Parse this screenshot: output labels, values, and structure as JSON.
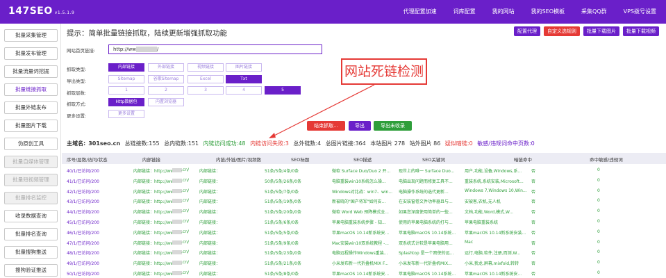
{
  "app": {
    "logo": "147SEO",
    "version": "v1.5.1.9"
  },
  "topnav": [
    "代理配置加速",
    "词库配置",
    "我的网站",
    "我的SEO模板",
    "采集QQ群",
    "VPS拨号设置"
  ],
  "sidebar": [
    {
      "label": "批量采集管理",
      "state": "normal"
    },
    {
      "label": "批量发布管理",
      "state": "normal"
    },
    {
      "label": "批量流量词挖掘",
      "state": "normal"
    },
    {
      "label": "批量链接抓取",
      "state": "active"
    },
    {
      "label": "批量外链发布",
      "state": "normal"
    },
    {
      "label": "批量图片下载",
      "state": "normal"
    },
    {
      "label": "伪原创工具",
      "state": "normal"
    },
    {
      "label": "批量自媒体管理",
      "state": "disabled"
    },
    {
      "label": "批量短视频管理",
      "state": "disabled"
    },
    {
      "label": "批量排名监控",
      "state": "disabled"
    },
    {
      "label": "收录数据查询",
      "state": "normal"
    },
    {
      "label": "批量排名查询",
      "state": "normal"
    },
    {
      "label": "批量搜狗推送",
      "state": "normal"
    },
    {
      "label": "搜狗验证推送",
      "state": "normal"
    }
  ],
  "tip": "提示：简单批量链接抓取，陆续更新增强抓取功能",
  "top_actions": [
    {
      "label": "配置代理",
      "color": "purple"
    },
    {
      "label": "自定义选规则",
      "color": "red"
    },
    {
      "label": "批量下载图片",
      "color": "purple"
    },
    {
      "label": "批量下载视频",
      "color": "purple"
    }
  ],
  "form": {
    "url_label": "网站首页链接:",
    "url_prefix": "http://ww",
    "url_suffix": "/",
    "grab_type_label": "抓取类型:",
    "grab_types": [
      {
        "label": "内部链接",
        "selected": true
      },
      {
        "label": "外部链接",
        "selected": false
      },
      {
        "label": "视频链接",
        "selected": false
      },
      {
        "label": "图片链接",
        "selected": false
      }
    ],
    "export_label": "导出类型:",
    "export_types": [
      {
        "label": "Sitemap",
        "selected": false
      },
      {
        "label": "谷歌Sitemap",
        "selected": false
      },
      {
        "label": "Excel",
        "selected": false
      },
      {
        "label": "Txt",
        "selected": true
      }
    ],
    "depth_label": "抓取层数:",
    "depths": [
      {
        "label": "1",
        "selected": false
      },
      {
        "label": "2",
        "selected": false
      },
      {
        "label": "3",
        "selected": false
      },
      {
        "label": "4",
        "selected": false
      },
      {
        "label": "5",
        "selected": true
      }
    ],
    "method_label": "抓取方式:",
    "methods": [
      {
        "label": "Http数据包",
        "selected": true
      },
      {
        "label": "内置浏览器",
        "selected": false
      }
    ],
    "more_label": "更多设置:",
    "more_button": "更多设置"
  },
  "actions": {
    "stop": "结束抓取...",
    "export": "导出",
    "export_fail": "导出未收录"
  },
  "annotation": "网站死链检测",
  "stats": {
    "domain_label": "主域名:",
    "domain": "301seo.cn",
    "total": "总链接数:155",
    "internal": "总内链数:151",
    "success": "内链访问成功:48",
    "fail": "内链访问失败:3",
    "external": "总外链数:4",
    "images": "总图片链接:364",
    "site_images": "本站图片 278",
    "ext_images": "站外图片 86",
    "dark_links": "疑似暗链:0",
    "sensitive": "敏感/违规词命中页数:0"
  },
  "table": {
    "headers": [
      "序号/层数/访问/状态",
      "内部链接",
      "内链/外链/图片/视频数",
      "SEO标题",
      "SEO描述",
      "SEO关键词",
      "暗链命中",
      "命中敏感/违规词"
    ],
    "rows": [
      {
        "status": "40/1/已访问/200",
        "link": "内部链接：http://www.3",
        "link_end": ".cn/",
        "link2": "内部链接：",
        "counts": "51条/5条/4条/0条",
        "title": "微软 Surface Duo/Duo 2 开...",
        "desc": "现世上的唯一 Surface Duo...",
        "keywords": "用户,功能,设备,Windows,系...",
        "dark": "否",
        "hit": "0"
      },
      {
        "status": "41/1/已访问/200",
        "link": "内部链接：http://www.3",
        "link_end": ".cn/",
        "link2": "内部链接：",
        "counts": "50条/5条/26条/0条",
        "title": "电脑重装win10系统怎么操...",
        "desc": "电脑出现问题而修复工具不...",
        "keywords": "重装系统,系统安装,Microsoft...",
        "dark": "否",
        "hit": "0"
      },
      {
        "status": "42/1/已访问/200",
        "link": "内部链接：http://www.",
        "link_end": ".cn/",
        "link2": "内部链接：",
        "counts": "51条/5条/7条/0条",
        "title": "Windows对比战：win7、win...",
        "desc": "电脑操作系统的选代更新...",
        "keywords": "Windows 7,Windows 10,Win...",
        "dark": "否",
        "hit": "0"
      },
      {
        "status": "43/1/已访问/200",
        "link": "内部链接：http://www.",
        "link_end": ".cn/",
        "link2": "内部链接：",
        "counts": "51条/5条/19条/0条",
        "title": "新被晓的\"国产将军\"如何安...",
        "desc": "在安装窗卷文件功率器且与...",
        "keywords": "安被客,农机,无人机",
        "dark": "否",
        "hit": "0"
      },
      {
        "status": "44/1/已访问/200",
        "link": "内部链接：http://www.",
        "link_end": ".cn/",
        "link2": "内部链接：",
        "counts": "51条/5条/20条/0条",
        "title": "微软 Word Web 预降模式全...",
        "desc": "如果您深度使用简单的一些...",
        "keywords": "文档,功能,Word,模式,W...",
        "dark": "否",
        "hit": "0"
      },
      {
        "status": "45/1/已访问/200",
        "link": "内部链接：http://www.",
        "link_end": ".cn/",
        "link2": "内部链接：",
        "counts": "51条/5条/6条/0条",
        "title": "苹果电脑重装系统步骤 - 知...",
        "desc": "使用的苹果电脑系统的打与...",
        "keywords": "苹果电脑重装系统",
        "dark": "否",
        "hit": "0"
      },
      {
        "status": "46/1/已访问/200",
        "link": "内部链接：http://www.",
        "link_end": ".cn/",
        "link2": "内部链接：",
        "counts": "51条/5条/5条/0条",
        "title": "苹果macOS 10.14新系统安...",
        "desc": "苹果电脑macOS 10.14系统...",
        "keywords": "苹果macOS 10.14新系统安装...",
        "dark": "否",
        "hit": "0"
      },
      {
        "status": "47/1/已访问/200",
        "link": "内部链接：http://ww",
        "link_end": ".cn/",
        "link2": "内部链接：",
        "counts": "51条/5条/9条/0条",
        "title": "Mac安装win10双系统教程 -...",
        "desc": "双系统式计较是苹果电脑用...",
        "keywords": "Mac",
        "dark": "否",
        "hit": "0"
      },
      {
        "status": "48/1/已访问/200",
        "link": "内部链接：http://ww",
        "link_end": ".cn/",
        "link2": "内部链接：",
        "counts": "51条/5条/23条/0条",
        "title": "电脑远程操作Windows重装...",
        "desc": "Splashtop 是一个跨使的远...",
        "keywords": "远行,电脑,软件,注册,而测,W...",
        "dark": "否",
        "hit": "0"
      },
      {
        "status": "49/1/已访问/200",
        "link": "内部链接：http://ww",
        "link_end": ".cn/",
        "link2": "内部链接：",
        "counts": "51条/5条/21条/0条",
        "title": "小米发布新一代折叠机MIX F...",
        "desc": "小米发布新一代折叠机MIX...",
        "keywords": "小米,我龙,屏幕,mixfold,转转",
        "dark": "否",
        "hit": "0"
      },
      {
        "status": "50/1/已访问/200",
        "link": "内部链接：http://ww",
        "link_end": ".cn/",
        "link2": "内部链接：",
        "counts": "51条/5条/8条/0条",
        "title": "苹果macOS 10.14新系统安...",
        "desc": "苹果电脑macOS 10.14系统...",
        "keywords": "苹果macOS 10.14新系统安...",
        "dark": "否",
        "hit": "0"
      }
    ]
  }
}
